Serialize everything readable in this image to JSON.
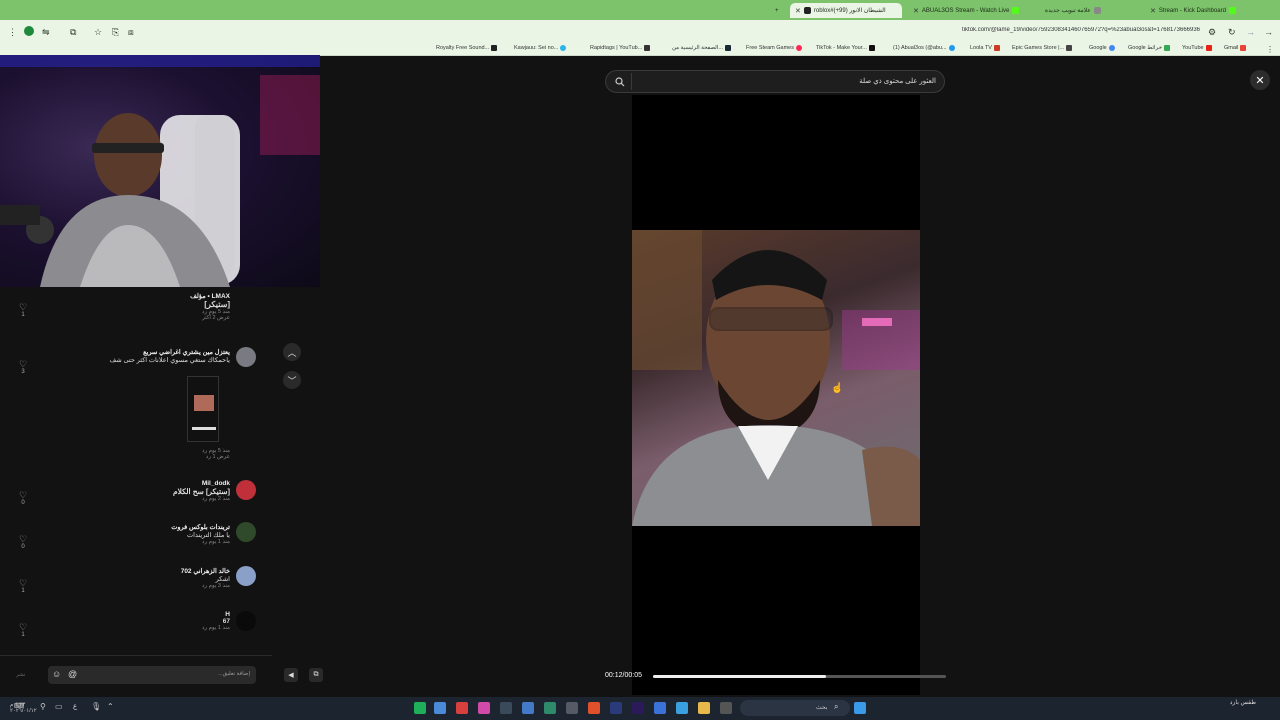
{
  "browser": {
    "tabs": [
      {
        "title": "roblox#(+99) الشيطان الانور",
        "active": true
      },
      {
        "title": "ABUAL3OS Stream - Watch Live",
        "active": false
      },
      {
        "title": "علامة تبويب جديدة",
        "active": false
      },
      {
        "title": "Stream - Kick Dashboard",
        "active": false
      }
    ],
    "url": "tiktok.com/@lame_19/video/7592308341460765972?q=%23abual3os&t=1768173666936",
    "bookmarks": [
      {
        "label": "Royalty Free Sound...",
        "color": "#e2962f"
      },
      {
        "label": "Kawjauu: Sei no...",
        "color": "#222222"
      },
      {
        "label": "Rapidtags | YouTub...",
        "color": "#2ab5e8"
      },
      {
        "label": "الصفحة الرئيسية من...",
        "color": "#333333"
      },
      {
        "label": "Free Steam Games",
        "color": "#1b2838"
      },
      {
        "label": "TikTok - Make Your...",
        "color": "#ff2a55"
      },
      {
        "label": "(1) Abual3os (@abu...",
        "color": "#111111"
      },
      {
        "label": "Loola TV",
        "color": "#1d9bf0"
      },
      {
        "label": "Epic Games Store |...",
        "color": "#cc3a2a"
      },
      {
        "label": "Google",
        "color": "#444444"
      },
      {
        "label": "Google خرائط",
        "color": "#4285f4"
      },
      {
        "label": "YouTube",
        "color": "#34a853"
      },
      {
        "label": "Gmail",
        "color": "#ea4335"
      }
    ]
  },
  "search": {
    "placeholder": "العثور على محتوى ذي صلة"
  },
  "player": {
    "time": "00:12/00:05",
    "progress": 0.59
  },
  "comments": [
    {
      "name": "LMAX • مؤلف",
      "text": "[ستيكر]",
      "meta": "منذ 5 يوم   رد",
      "replies": "عرض 2 أكثر",
      "likes": "1"
    },
    {
      "name": "يعتزل مين يشتري اغراضي سريع",
      "text": "ياحمكاك ستغي مسوي اعلانات اكثر حتى شف",
      "meta": "منذ 5 يوم   رد",
      "replies": "عرض 1 رد",
      "likes": "3"
    },
    {
      "name": "Mil_dodk",
      "text": "[ستيكر] سح الكلام",
      "meta": "منذ 2 يوم   رد",
      "replies": "",
      "likes": "0"
    },
    {
      "name": "تريندات بلوكس فروت",
      "text": "يا ملك التريندات",
      "meta": "منذ 1 يوم   رد",
      "replies": "",
      "likes": "0"
    },
    {
      "name": "خالد الزهراني 702",
      "text": "اشكر",
      "meta": "منذ 3 يوم   رد",
      "replies": "",
      "likes": "1"
    },
    {
      "name": "H",
      "text": "67",
      "meta": "منذ 1 يوم   رد",
      "replies": "",
      "likes": "1"
    }
  ],
  "comment_box": {
    "placeholder": "إضافة تعليق...",
    "post_label": "نشر"
  },
  "taskbar": {
    "search_label": "بحث",
    "clock_time": "٤:٢٣ م",
    "clock_date": "٢٠٢٦/٠١/١٢",
    "weather": "طقس بارد"
  }
}
